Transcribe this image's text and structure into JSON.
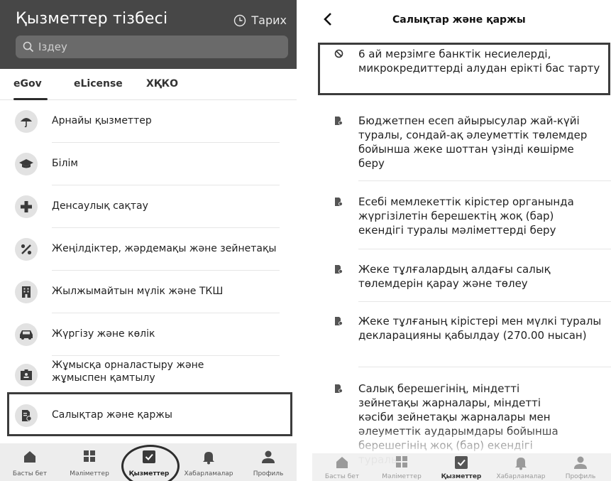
{
  "left": {
    "header": {
      "title": "Қызметтер тізбесі",
      "history_label": "Тарих"
    },
    "search": {
      "placeholder": "Іздеу"
    },
    "tabs": [
      {
        "label": "eGov"
      },
      {
        "label": "eLicense"
      },
      {
        "label": "ХҚКО"
      }
    ],
    "services": [
      {
        "label": "Арнайы қызметтер",
        "icon": "umbrella-icon"
      },
      {
        "label": "Білім",
        "icon": "graduation-cap-icon"
      },
      {
        "label": "Денсаулық сақтау",
        "icon": "plus-icon"
      },
      {
        "label": "Жеңілдіктер, жәрдемақы және зейнетақы",
        "icon": "percent-icon"
      },
      {
        "label": "Жылжымайтын мүлік және ТКШ",
        "icon": "building-icon"
      },
      {
        "label": "Жүргізу және көлік",
        "icon": "car-icon"
      },
      {
        "label": "Жұмысқа орналастыру және\nжұмыспен қамтылу",
        "icon": "id-badge-icon"
      },
      {
        "label": "Салықтар және қаржы",
        "icon": "tax-document-icon"
      }
    ],
    "nav": [
      {
        "label": "Басты бет",
        "icon": "home-icon"
      },
      {
        "label": "Мәліметтер",
        "icon": "grid-icon"
      },
      {
        "label": "Қызметтер",
        "icon": "check-box-icon"
      },
      {
        "label": "Хабарламалар",
        "icon": "bell-icon"
      },
      {
        "label": "Профиль",
        "icon": "user-icon"
      }
    ]
  },
  "right": {
    "header": {
      "title": "Салықтар және қаржы"
    },
    "items": [
      {
        "text": "6 ай мерзімге банктік несиелерді, микрокредиттерді алудан ерікті бас тарту",
        "icon": "block-icon"
      },
      {
        "text": "Бюджетпен есеп айырысулар жай-күйі туралы, сондай-ақ әлеуметтік төлемдер бойынша жеке шоттан үзінді көшірме беру",
        "icon": "tax-document-icon"
      },
      {
        "text": "Есебі мемлекеттік кірістер органында жүргізілетін берешектің жоқ (бар) екендігі туралы мәліметтерді беру",
        "icon": "tax-document-icon"
      },
      {
        "text": "Жеке тұлғалардың алдағы салық төлемдерін қарау және төлеу",
        "icon": "tax-document-icon"
      },
      {
        "text": "Жеке тұлғаның кірістері мен мүлкі туралы декларацияны қабылдау (270.00 нысан)",
        "icon": "tax-document-icon"
      },
      {
        "text": "Салық берешегінің, міндетті зейнетақы жарналары, міндетті кәсіби зейнетақы жарналары мен әлеуметтік аударымдары бойынша берешегінің жоқ (бар) екендігі туралы",
        "icon": "tax-document-icon"
      }
    ],
    "nav": [
      {
        "label": "Басты бет",
        "icon": "home-icon"
      },
      {
        "label": "Мәліметтер",
        "icon": "grid-icon"
      },
      {
        "label": "Қызметтер",
        "icon": "check-box-icon"
      },
      {
        "label": "Хабарламалар",
        "icon": "bell-icon"
      },
      {
        "label": "Профиль",
        "icon": "user-icon"
      }
    ]
  },
  "colors": {
    "header_bg": "#474747",
    "search_bg": "#6a6a6a",
    "icon_circle": "#e2e2e2",
    "highlight": "#3c3c3c",
    "nav_bg": "#ededed"
  }
}
